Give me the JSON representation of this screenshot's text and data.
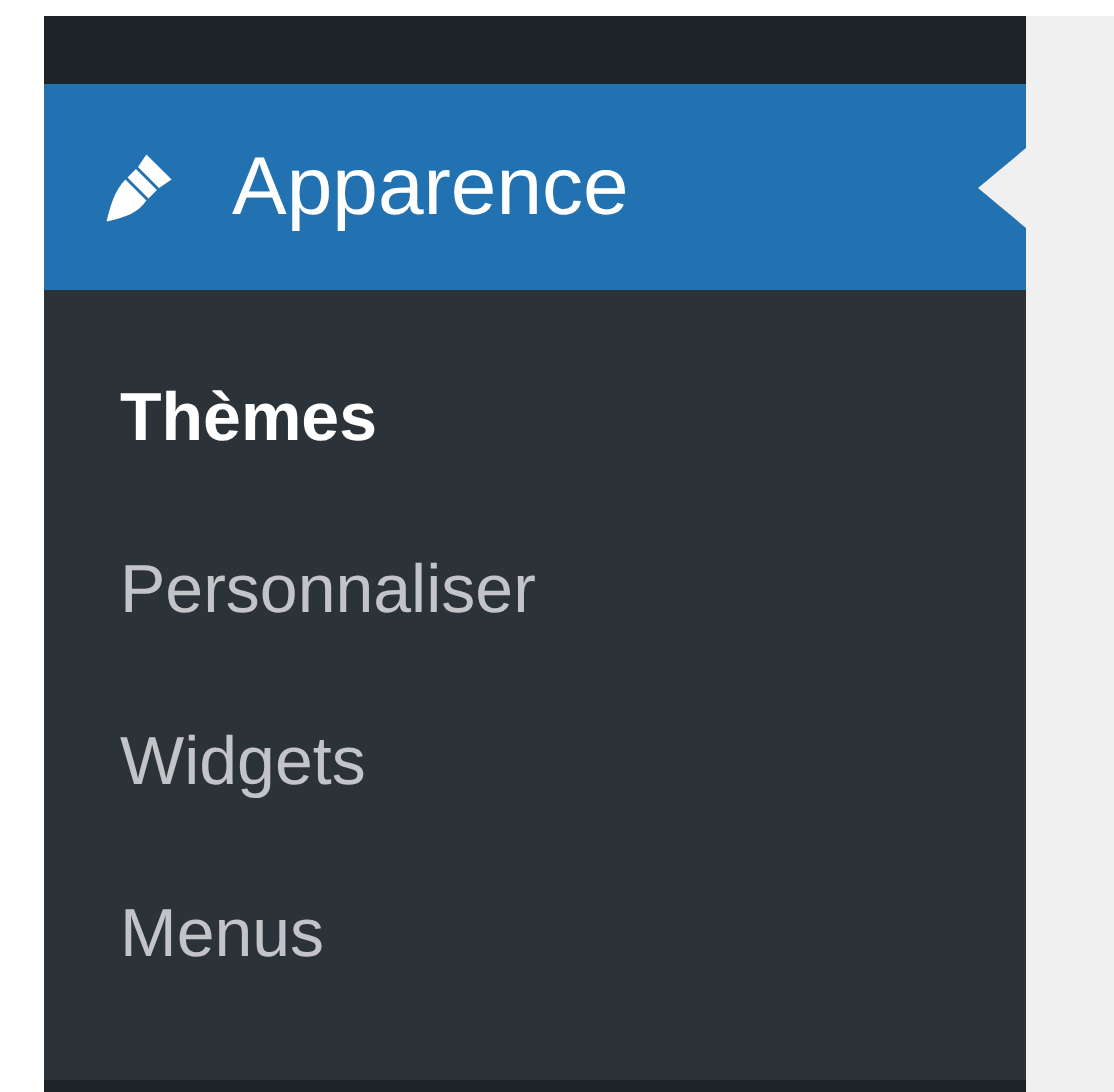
{
  "menu": {
    "label": "Apparence",
    "selected": true,
    "items": [
      {
        "label": "Thèmes",
        "selected": true
      },
      {
        "label": "Personnaliser",
        "selected": false
      },
      {
        "label": "Widgets",
        "selected": false
      },
      {
        "label": "Menus",
        "selected": false
      }
    ]
  }
}
